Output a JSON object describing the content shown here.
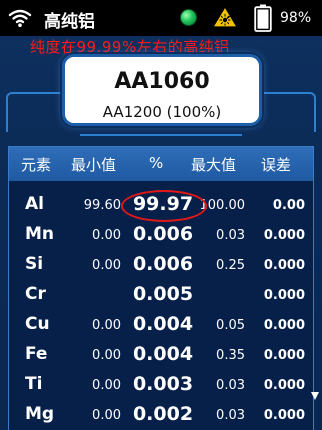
{
  "statusbar": {
    "title": "高纯铝",
    "battery_pct": "98%",
    "icons": [
      "wifi-icon",
      "status-led-icon",
      "laser-warning-icon",
      "battery-icon"
    ],
    "led_color": "#1ec45a"
  },
  "annotation": "纯度在99.99%左右的高纯铝",
  "grade": {
    "main": "AA1060",
    "sub": "AA1200 (100%)"
  },
  "table": {
    "headers": [
      "元素",
      "最小值",
      "%",
      "最大值",
      "误差"
    ],
    "rows": [
      {
        "element": "Al",
        "min": "99.60",
        "pct": "99.97",
        "max": "100.00",
        "err": "0.00"
      },
      {
        "element": "Mn",
        "min": "0.00",
        "pct": "0.006",
        "max": "0.03",
        "err": "0.000"
      },
      {
        "element": "Si",
        "min": "0.00",
        "pct": "0.006",
        "max": "0.25",
        "err": "0.000"
      },
      {
        "element": "Cr",
        "min": "",
        "pct": "0.005",
        "max": "",
        "err": "0.000"
      },
      {
        "element": "Cu",
        "min": "0.00",
        "pct": "0.004",
        "max": "0.05",
        "err": "0.000"
      },
      {
        "element": "Fe",
        "min": "0.00",
        "pct": "0.004",
        "max": "0.35",
        "err": "0.000"
      },
      {
        "element": "Ti",
        "min": "0.00",
        "pct": "0.003",
        "max": "0.03",
        "err": "0.000"
      },
      {
        "element": "Mg",
        "min": "0.00",
        "pct": "0.002",
        "max": "0.03",
        "err": "0.000"
      }
    ]
  },
  "colors": {
    "background": "#0b2a55",
    "header": "#2f6db8",
    "annotation": "#ff1a1a"
  }
}
